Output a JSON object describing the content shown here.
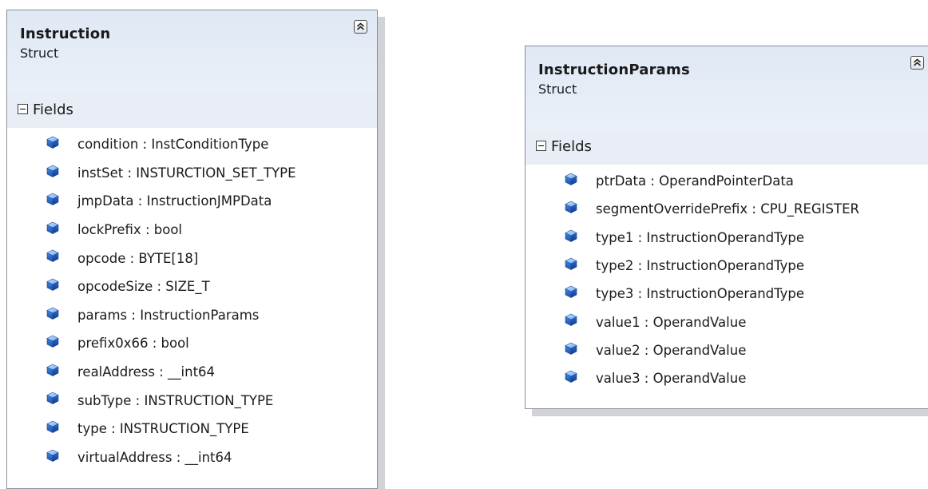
{
  "shapes": [
    {
      "name": "Instruction",
      "kind": "Struct",
      "section": "Fields",
      "fields": [
        "condition : InstConditionType",
        "instSet : INSTURCTION_SET_TYPE",
        "jmpData : InstructionJMPData",
        "lockPrefix : bool",
        "opcode : BYTE[18]",
        "opcodeSize : SIZE_T",
        "params : InstructionParams",
        "prefix0x66 : bool",
        "realAddress : __int64",
        "subType : INSTRUCTION_TYPE",
        "type : INSTRUCTION_TYPE",
        "virtualAddress : __int64"
      ]
    },
    {
      "name": "InstructionParams",
      "kind": "Struct",
      "section": "Fields",
      "fields": [
        "ptrData : OperandPointerData",
        "segmentOverridePrefix : CPU_REGISTER",
        "type1 : InstructionOperandType",
        "type2 : InstructionOperandType",
        "type3 : InstructionOperandType",
        "value1 : OperandValue",
        "value2 : OperandValue",
        "value3 : OperandValue"
      ]
    }
  ],
  "icons": {
    "collapse": "double-chevron-up-icon",
    "section_toggle": "minus-box-icon",
    "field": "field-cube-icon"
  },
  "colors": {
    "header_bg": "#dfe8f4",
    "section_bg": "#e9eef6",
    "border": "#8a8f98",
    "shadow": "#d2d3d6",
    "field_icon": "#2d6fd1"
  }
}
